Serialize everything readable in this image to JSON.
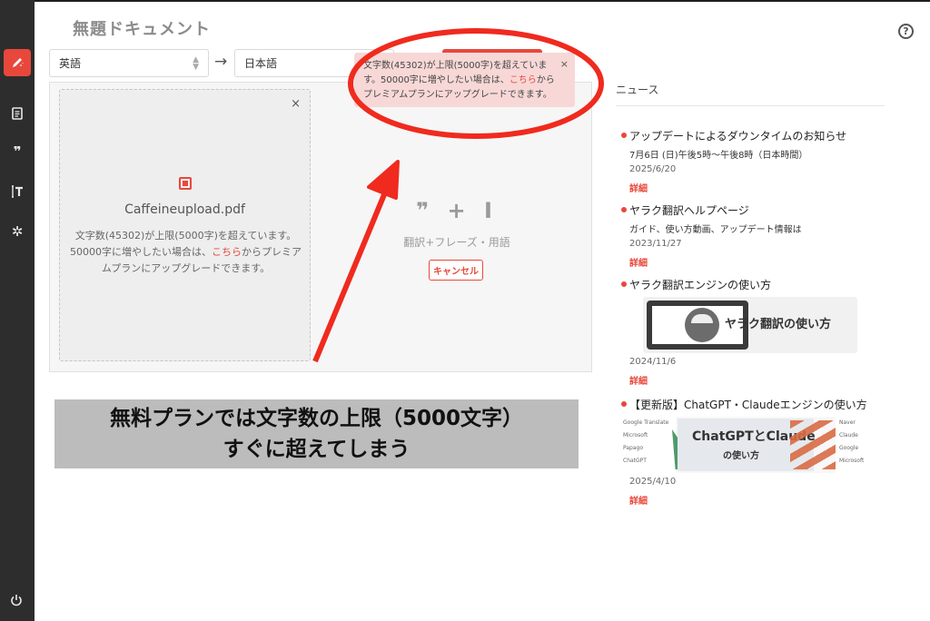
{
  "document": {
    "title": "無題ドキュメント"
  },
  "sidebar": {
    "items": [
      {
        "name": "edit",
        "icon": "pen-icon",
        "active": true
      },
      {
        "name": "documents",
        "icon": "document-icon"
      },
      {
        "name": "phrases",
        "icon": "quote-icon",
        "glyph": "❞"
      },
      {
        "name": "glossary",
        "icon": "text-cursor-icon"
      },
      {
        "name": "settings",
        "icon": "gear-icon",
        "glyph": "✲"
      }
    ],
    "bottom_icon": "power-icon"
  },
  "header": {
    "help_glyph": "?"
  },
  "language": {
    "source": "英語",
    "target": "日本語",
    "arrow": "→"
  },
  "upload": {
    "file_name": "Caffeineupload.pdf",
    "message_before": "文字数(45302)が上限(5000字)を超えています。50000字に増やしたい場合は、",
    "message_link": "こちら",
    "message_after": "からプレミアムプランにアップグレードできます。",
    "close_glyph": "×"
  },
  "features": {
    "icons": "❞ + Ⅰ",
    "label": "翻訳+フレーズ・用語",
    "cancel_label": "キャンセル"
  },
  "toast": {
    "message_before": "文字数(45302)が上限(5000字)を超えています。50000字に増やしたい場合は、",
    "message_link": "こちら",
    "message_after": "からプレミアムプランにアップグレードできます。",
    "close_glyph": "×"
  },
  "annotation": {
    "caption_line1": "無料プランでは文字数の上限（5000文字）",
    "caption_line2": "すぐに超えてしまう",
    "accent_color": "#f02a1e"
  },
  "news": {
    "heading": "ニュース",
    "more_label": "詳細",
    "items": [
      {
        "title": "アップデートによるダウンタイムのお知らせ",
        "subtitle": "7月6日 (日)午後5時〜午後8時（日本時間）",
        "date": "2025/6/20"
      },
      {
        "title": "ヤラク翻訳ヘルプページ",
        "subtitle": "ガイド、使い方動画、アップデート情報は",
        "date": "2023/11/27"
      },
      {
        "title": "ヤラク翻訳エンジンの使い方",
        "thumb_title": "ヤラク翻訳の使い方",
        "date": "2024/11/6"
      },
      {
        "title": "【更新版】ChatGPT・Claudeエンジンの使い方",
        "thumb_title": "ChatGPTとClaude",
        "thumb_sub": "の使い方",
        "date": "2025/4/10"
      }
    ]
  },
  "colors": {
    "brand_red": "#e8483b",
    "sidebar_bg": "#2d2d2d",
    "toast_bg": "#f7d8d7"
  }
}
